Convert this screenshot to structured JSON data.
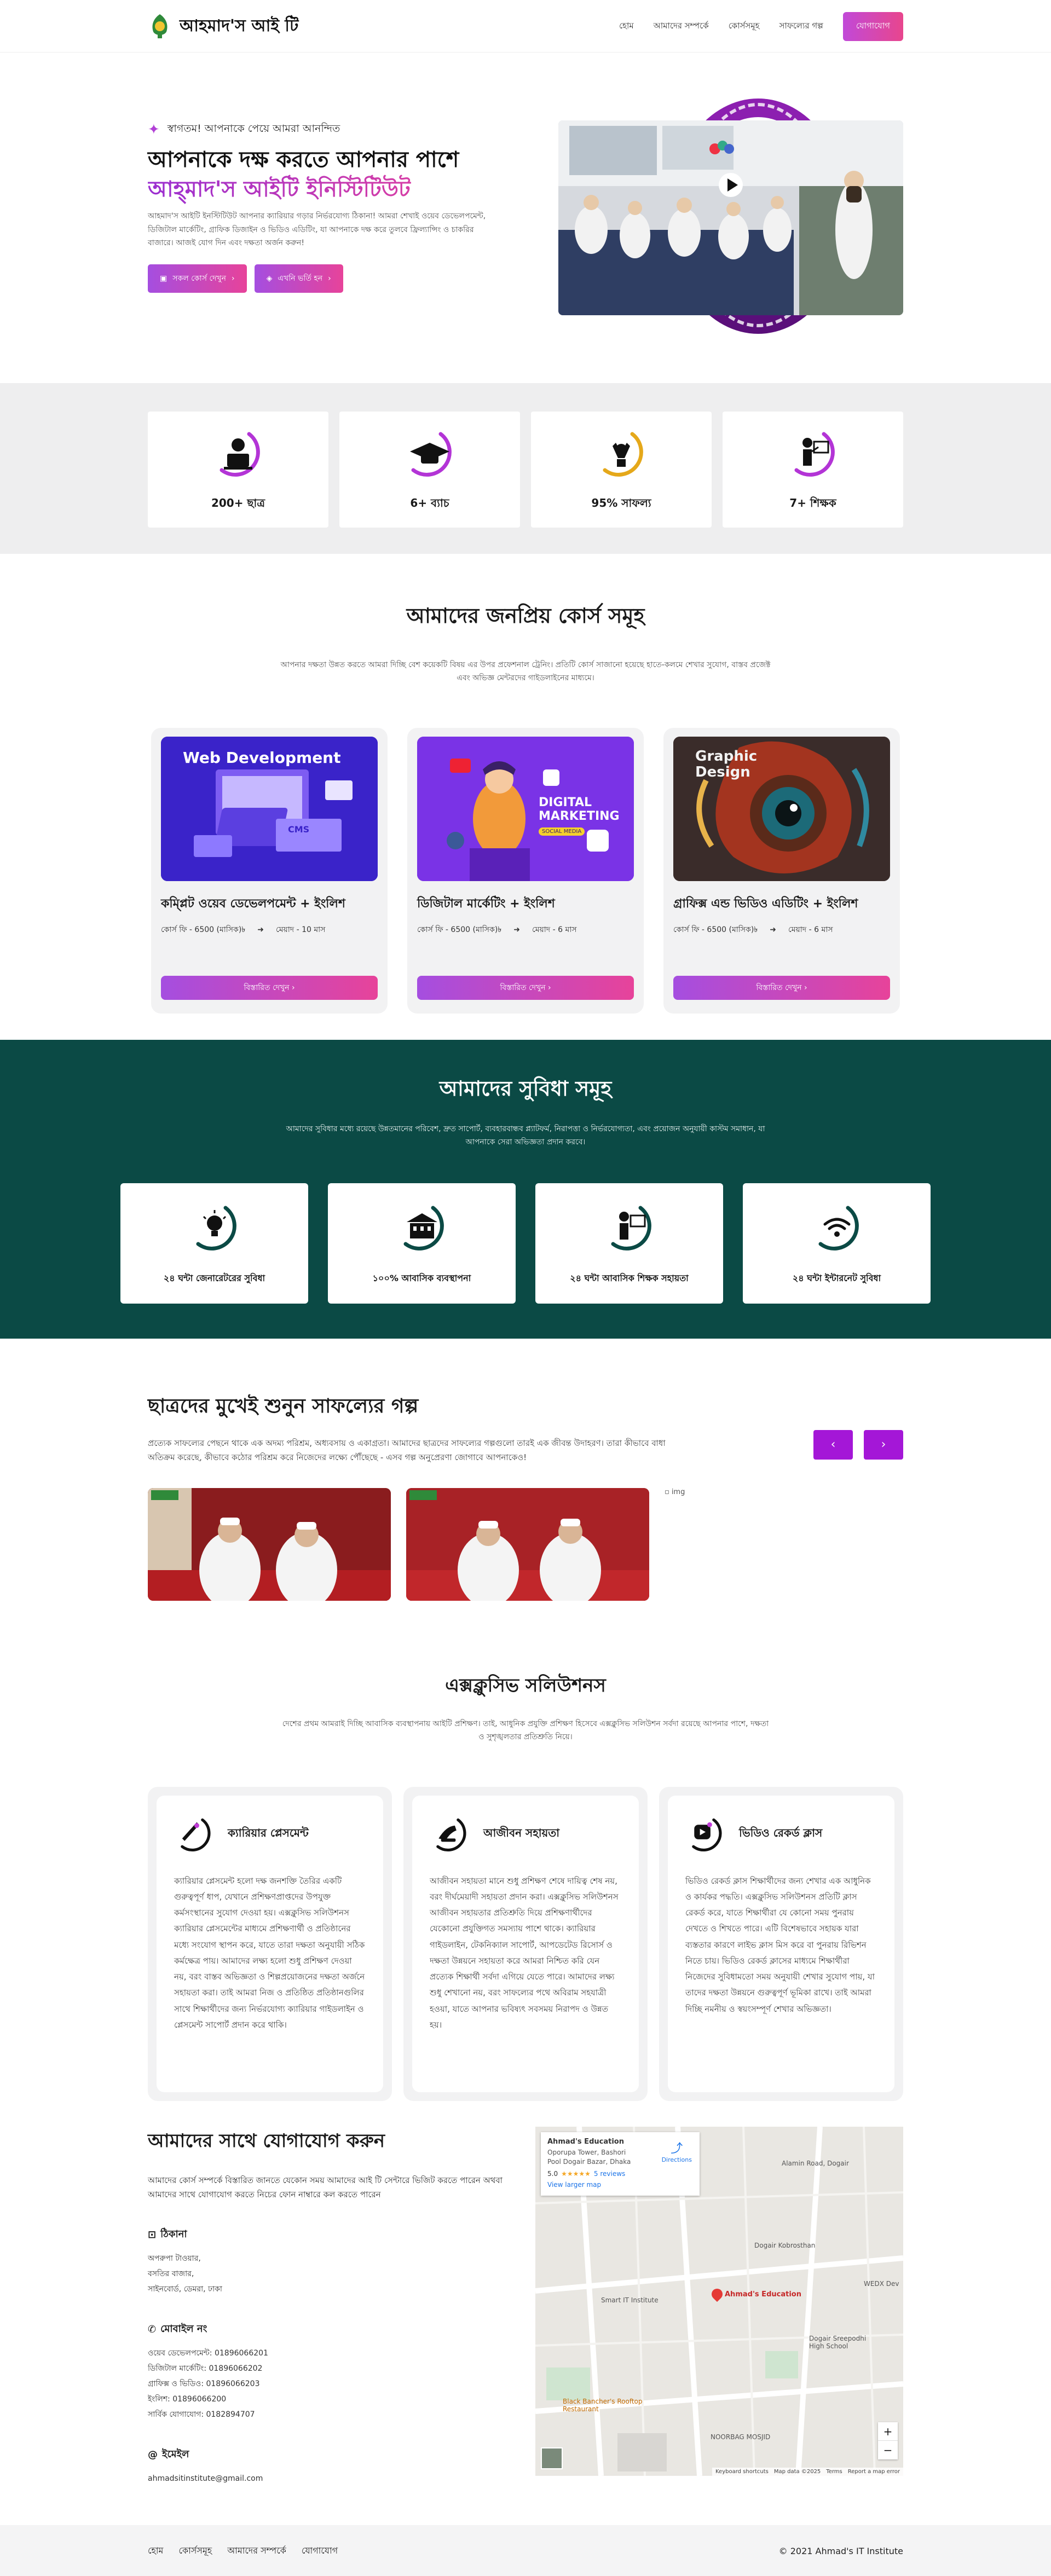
{
  "header": {
    "logo_text": "আহমাদ'স আই টি",
    "nav": [
      "হোম",
      "আমাদের সম্পর্কে",
      "কোর্সসমূহ",
      "সাফল্যের গল্প"
    ],
    "cta": "যোগাযোগ"
  },
  "hero": {
    "badge": "স্বাগতম! আপনাকে পেয়ে আমরা আনন্দিত",
    "title": "আপনাকে দক্ষ করতে আপনার পাশে",
    "title2": "আহ্‌মাদ'স আইটি ইনিস্টিটিউট",
    "desc": "আহমাদ'স আইটি ইনস্টিটিউট আপনার ক্যারিয়ার গড়ার নির্ভরযোগ্য ঠিকানা! আমরা শেখাই ওয়েব ডেভেলপমেন্ট, ডিজিটাল মার্কেটিং, গ্রাফিক ডিজাইন ও ভিডিও এডিটিং, যা আপনাকে দক্ষ করে তুলবে ফ্রিল্যান্সিং ও চাকরির বাজারে। আজই যোগ দিন এবং দক্ষতা অর্জন করুন!",
    "btn1": "সকল কোর্স দেখুন",
    "btn2": "এখনি ভর্তি হন"
  },
  "stats": [
    {
      "value": "200+ ছাত্র",
      "icon": "student-laptop-icon"
    },
    {
      "value": "6+ ব্যাচ",
      "icon": "graduation-cap-icon"
    },
    {
      "value": "95% সাফল্য",
      "icon": "success-trophy-icon"
    },
    {
      "value": "7+ শিক্ষক",
      "icon": "teacher-board-icon"
    }
  ],
  "courses": {
    "title": "আমাদের জনপ্রিয় কোর্স সমূহ",
    "desc": "আপনার দক্ষতা উন্নত করতে আমরা দিচ্ছি বেশ কয়েকটি বিষয় এর উপর প্রফেশনাল ট্রেনিং। প্রতিটি কোর্স সাজানো হয়েছে হাতে-কলমে শেখার সুযোগ, বাস্তব প্রজেক্ট এবং অভিজ্ঞ মেন্টরদের গাইডলাইনের মাধ্যমে।",
    "items": [
      {
        "img_label": "Web Development",
        "img_sub": "CMS",
        "title": "কম্প্লিট ওয়েব ডেভেলপমেন্ট + ইংলিশ",
        "fee": "কোর্স ফি - 6500 (মাসিক)৳",
        "duration": "মেয়াদ - 10 মাস",
        "btn": "বিস্তারিত দেখুন"
      },
      {
        "img_label": "DIGITAL MARKETING",
        "img_sub": "SOCIAL MEDIA",
        "title": "ডিজিটাল মার্কেটিং + ইংলিশ",
        "fee": "কোর্স ফি - 6500 (মাসিক)৳",
        "duration": "মেয়াদ - 6 মাস",
        "btn": "বিস্তারিত দেখুন"
      },
      {
        "img_label": "Graphic Design",
        "img_sub": "",
        "title": "গ্রাফিক্স এন্ড ভিডিও এডিটিং + ইংলিশ",
        "fee": "কোর্স ফি - 6500 (মাসিক)৳",
        "duration": "মেয়াদ - 6 মাস",
        "btn": "বিস্তারিত দেখুন"
      }
    ]
  },
  "facilities": {
    "title": "আমাদের সুবিধা সমূহ",
    "desc": "আমাদের সুবিধার মধ্যে রয়েছে উন্নতমানের পরিবেশ, দ্রুত সাপোর্ট, ব্যবহারবান্ধব প্ল্যাটফর্ম, নিরাপত্তা ও নির্ভরযোগ্যতা, এবং প্রয়োজন অনুযায়ী কাস্টম সমাধান, যা আপনাকে সেরা অভিজ্ঞতা প্রদান করবে।",
    "items": [
      {
        "label": "২৪ ঘন্টা জেনারেটরের সুবিধা",
        "icon": "lightbulb-icon"
      },
      {
        "label": "১০০% আবাসিক ব্যবস্থাপনা",
        "icon": "building-icon"
      },
      {
        "label": "২৪ ঘন্টা আবাসিক শিক্ষক সহায়তা",
        "icon": "teacher-icon"
      },
      {
        "label": "২৪ ঘন্টা ইন্টারনেট সুবিধা",
        "icon": "wifi-icon"
      }
    ]
  },
  "success": {
    "title": "ছাত্রদের মুখেই শুনুন সাফল্যের গল্প",
    "desc": "প্রত্যেক সাফল্যের পেছনে থাকে এক অদম্য পরিশ্রম, অধ্যবসায় ও একাগ্রতা। আমাদের ছাত্রদের সাফল্যের গল্পগুলো তারই এক জীবন্ত উদাহরণ। তারা কীভাবে বাধা অতিক্রম করেছে, কীভাবে কঠোর পরিশ্রম করে নিজেদের লক্ষ্যে পৌঁছেছে - এসব গল্প অনুপ্রেরণা জোগাবে আপনাকেও!",
    "broken_img": "img"
  },
  "exclusive": {
    "title": "এক্সক্লুসিভ সলিউশনস",
    "desc": "দেশের প্রথম আমরাই দিচ্ছি আবাসিক ব্যবস্থাপনায় আইটি প্রশিক্ষণ। তাই, আধুনিক প্রযুক্তি প্রশিক্ষণ হিসেবে এক্সক্লুসিভ সলিউশন সর্বদা রয়েছে আপনার পাশে, দক্ষতা ও সুশৃঙ্খলতার প্রতিশ্রুতি নিয়ে।",
    "items": [
      {
        "title": "ক্যারিয়ার প্লেসমেন্ট",
        "icon": "career-rocket-icon",
        "body": "ক্যারিয়ার প্লেসমেন্ট হলো দক্ষ জনশক্তি তৈরির একটি গুরুত্বপূর্ণ ধাপ, যেখানে প্রশিক্ষণপ্রাপ্তদের উপযুক্ত কর্মসংস্থানের সুযোগ দেওয়া হয়। এক্সক্লুসিভ সলিউশনস ক্যারিয়ার প্লেসমেন্টের মাধ্যমে প্রশিক্ষণার্থী ও প্রতিষ্ঠানের মধ্যে সংযোগ স্থাপন করে, যাতে তারা দক্ষতা অনুযায়ী সঠিক কর্মক্ষেত্র পায়। আমাদের লক্ষ্য হলো শুধু প্রশিক্ষণ দেওয়া নয়, বরং বাস্তব অভিজ্ঞতা ও শিল্পপ্রয়োজনের দক্ষতা অর্জনে সহায়তা করা। তাই আমরা নিজ ও প্রতিষ্ঠিত প্রতিষ্ঠানগুলির সাথে শিক্ষার্থীদের জন্য নির্ভরযোগ্য ক্যারিয়ার গাইডলাইন ও প্লেসমেন্ট সাপোর্ট প্রদান করে থাকি।"
      },
      {
        "title": "আজীবন সহায়তা",
        "icon": "lifetime-support-icon",
        "body": "আজীবন সহায়তা মানে শুধু প্রশিক্ষণ শেষে দায়িত্ব শেষ নয়, বরং দীর্ঘমেয়াদী সহায়তা প্রদান করা। এক্সক্লুসিভ সলিউশনস আজীবন সহায়তার প্রতিশ্রুতি দিয়ে প্রশিক্ষণার্থীদের যেকোনো প্রযুক্তিগত সমস্যায় পাশে থাকে। ক্যারিয়ার গাইডলাইন, টেকনিক্যাল সাপোর্ট, আপডেটেড রিসোর্স ও দক্ষতা উন্নয়নে সহায়তা করে আমরা নিশ্চিত করি যেন প্রত্যেক শিক্ষার্থী সর্বদা এগিয়ে যেতে পারে। আমাদের লক্ষ্য শুধু শেখানো নয়, বরং সাফল্যের পথে অবিরাম সহযাত্রী হওয়া, যাতে আপনার ভবিষ্যৎ সবসময় নিরাপদ ও উন্নত হয়।"
      },
      {
        "title": "ভিডিও রেকর্ড ক্লাস",
        "icon": "video-play-icon",
        "body": "ভিডিও রেকর্ড ক্লাস শিক্ষার্থীদের জন্য শেখার এক আধুনিক ও কার্যকর পদ্ধতি। এক্সক্লুসিভ সলিউশনস প্রতিটি ক্লাস রেকর্ড করে, যাতে শিক্ষার্থীরা যে কোনো সময় পুনরায় দেখতে ও শিখতে পারে। এটি বিশেষভাবে সহায়ক যারা ব্যস্ততার কারণে লাইভ ক্লাস মিস করে বা পুনরায় রিভিশন নিতে চায়। ভিডিও রেকর্ড ক্লাসের মাধ্যমে শিক্ষার্থীরা নিজেদের সুবিধামতো সময় অনুযায়ী শেখার সুযোগ পায়, যা তাদের দক্ষতা উন্নয়নে গুরুত্বপূর্ণ ভূমিকা রাখে। তাই আমরা দিচ্ছি নমনীয় ও স্বয়ংসম্পূর্ণ শেখার অভিজ্ঞতা।"
      }
    ]
  },
  "contact": {
    "title": "আমাদের সাথে যোগাযোগ করুন",
    "desc": "আমাদের কোর্স সম্পর্কে বিস্তারিত জানতে যেকোন সময় আমাদের আই টি সেন্টারে ভিজিট করতে পারেন অথবা আমাদের সাথে যোগাযোগ করতে নিচের ফোন নাম্বারে কল করতে পারেন",
    "address_h": "ঠিকানা",
    "address": [
      "অপরুপা টাওয়ার,",
      "বসতির বাজার,",
      "সাইনবোর্ড, ডেমরা, ঢাকা"
    ],
    "phone_h": "মোবাইল নং",
    "phones": [
      "ওয়েব ডেভেলপমেন্ট: 01896066201",
      "ডিজিটাল মার্কেটিং: 01896066202",
      "গ্রাফিক্স ও ভিডিও: 01896066203",
      "ইংলিশ: 01896066200",
      "সার্বিক যোগাযোগ: 0182894707"
    ],
    "email_h": "ইমেইল",
    "email": "ahmadsitinstitute@gmail.com",
    "map": {
      "place": "Ahmad's Education",
      "address": "Oporupa Tower, Bashori Pool Dogair Bazar, Dhaka",
      "rating": "5.0",
      "stars": "★★★★★",
      "reviews": "5 reviews",
      "larger": "View larger map",
      "directions": "Directions",
      "marker": "Ahmad's Education",
      "labels": [
        "Alamin Road, Dogair",
        "Dogair Kobrosthan",
        "Smart IT Institute",
        "Black Bancher's Rooftop Restaurant",
        "NOORBAG MOSJID",
        "Dogair Sreepodhi High School",
        "WEDX Dev"
      ],
      "footer": [
        "Keyboard shortcuts",
        "Map data ©2025",
        "Terms",
        "Report a map error"
      ],
      "zoom_in": "+",
      "zoom_out": "−"
    }
  },
  "footer": {
    "links": [
      "হোম",
      "কোর্সসমূহ",
      "আমাদের সম্পর্কে",
      "যোগাযোগ"
    ],
    "copy": "© 2021 Ahmad's IT Institute"
  },
  "colors": {
    "accent": "#a417d7",
    "pink": "#e7439a",
    "teal": "#0b4a45"
  }
}
